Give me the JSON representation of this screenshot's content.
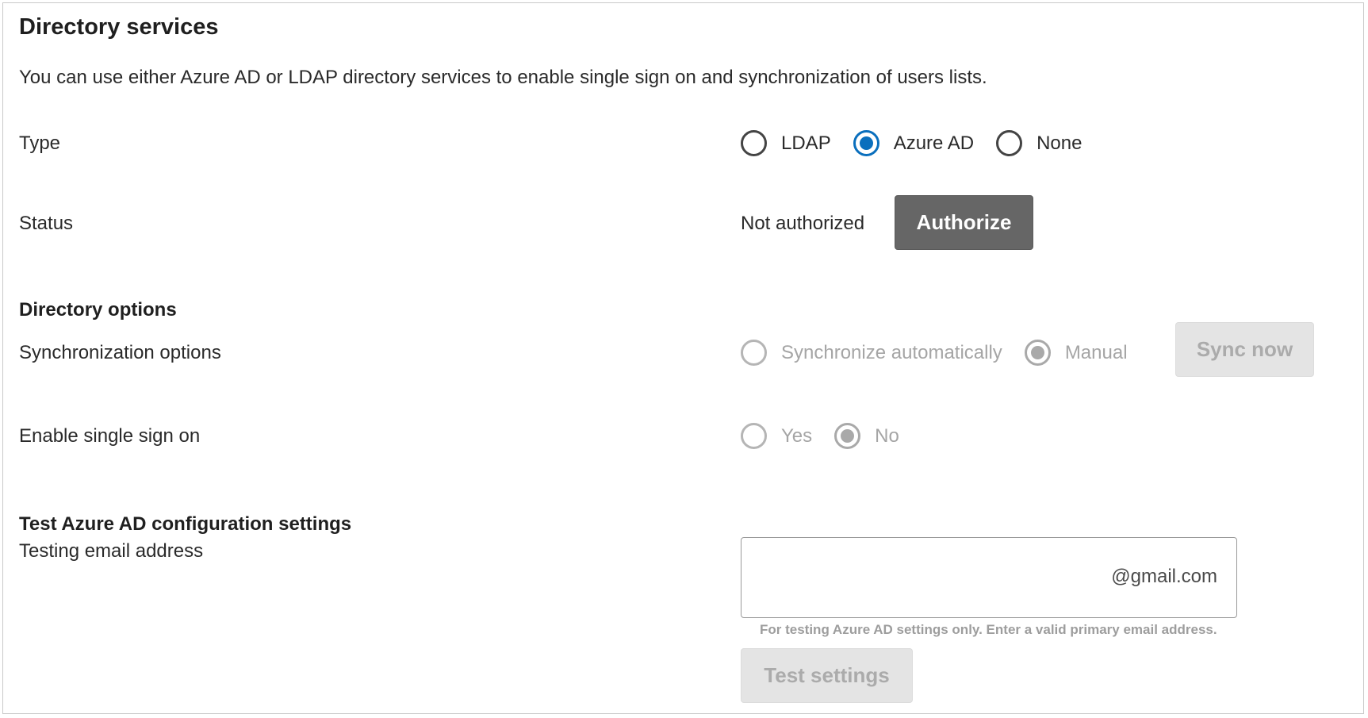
{
  "page": {
    "title": "Directory services",
    "description": "You can use either Azure AD or LDAP directory services to enable single sign on and synchronization of users lists."
  },
  "type_row": {
    "label": "Type",
    "options": [
      {
        "label": "LDAP",
        "checked": false
      },
      {
        "label": "Azure AD",
        "checked": true
      },
      {
        "label": "None",
        "checked": false
      }
    ]
  },
  "status_row": {
    "label": "Status",
    "value": "Not authorized",
    "authorize_button": "Authorize"
  },
  "directory_options": {
    "heading": "Directory options",
    "sync": {
      "label": "Synchronization options",
      "options": [
        {
          "label": "Synchronize automatically",
          "checked": false
        },
        {
          "label": "Manual",
          "checked": true
        }
      ],
      "sync_button": "Sync now"
    },
    "sso": {
      "label": "Enable single sign on",
      "options": [
        {
          "label": "Yes",
          "checked": false
        },
        {
          "label": "No",
          "checked": true
        }
      ]
    }
  },
  "test_section": {
    "heading": "Test Azure AD configuration settings",
    "email_label": "Testing email address",
    "email_value": "",
    "email_suffix": "@gmail.com",
    "hint": "For testing Azure AD settings only. Enter a valid primary email address.",
    "test_button": "Test settings"
  },
  "colors": {
    "accent": "#0a6fbd",
    "primary_button": "#666666",
    "disabled_button": "#e4e4e4",
    "disabled_text": "#a5a5a5"
  }
}
